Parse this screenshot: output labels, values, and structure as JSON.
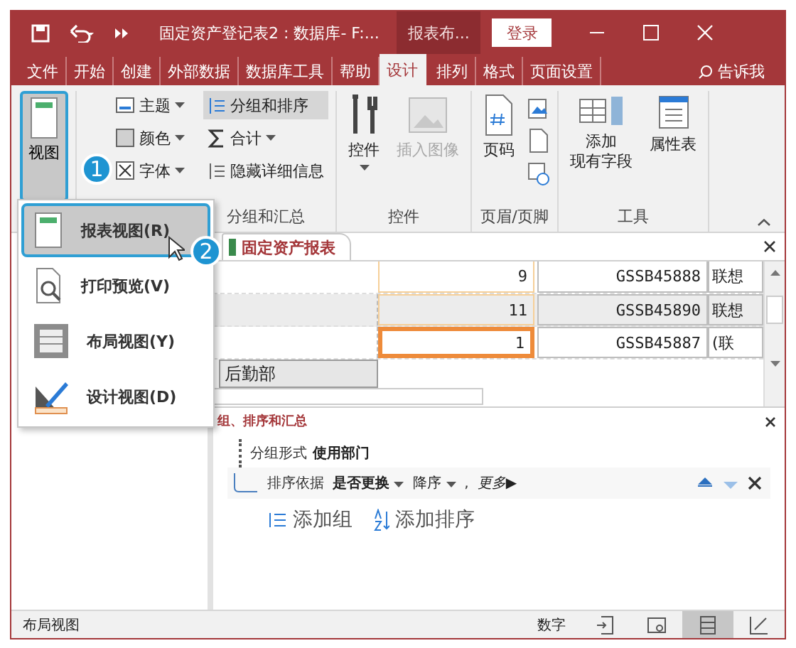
{
  "title_bar": {
    "title": "固定资产登记表2 : 数据库- F:...",
    "context_tab": "报表布...",
    "login": "登录"
  },
  "menu_tabs": [
    {
      "label": "文件",
      "selected": false
    },
    {
      "label": "开始",
      "selected": false
    },
    {
      "label": "创建",
      "selected": false
    },
    {
      "label": "外部数据",
      "selected": false
    },
    {
      "label": "数据库工具",
      "selected": false
    },
    {
      "label": "帮助",
      "selected": false
    },
    {
      "label": "设计",
      "selected": true
    },
    {
      "label": "排列",
      "selected": false
    },
    {
      "label": "格式",
      "selected": false
    },
    {
      "label": "页面设置",
      "selected": false
    }
  ],
  "tell_me": "告诉我",
  "ribbon": {
    "view_button": {
      "label": "视图",
      "selected": true
    },
    "theme_items": [
      "主题",
      "颜色",
      "字体"
    ],
    "grouping_items": [
      {
        "label": "分组和排序",
        "selected": true
      },
      {
        "label": "合计",
        "selected": false
      },
      {
        "label": "隐藏详细信息",
        "selected": false
      }
    ],
    "grouping_label": "分组和汇总",
    "controls": {
      "label": "控件",
      "insert_image": "插入图像",
      "group_label": "控件"
    },
    "header_footer": {
      "page_number": "页码",
      "group_label": "页眉/页脚"
    },
    "tools": {
      "add_fields": [
        "添加",
        "现有字段"
      ],
      "property_sheet": "属性表",
      "group_label": "工具"
    }
  },
  "view_menu": [
    {
      "label": "报表视图(R)",
      "selected": true
    },
    {
      "label": "打印预览(V)",
      "selected": false
    },
    {
      "label": "布局视图(Y)",
      "selected": false
    },
    {
      "label": "设计视图(D)",
      "selected": false
    }
  ],
  "callouts": [
    "1",
    "2"
  ],
  "document_tab": {
    "label": "固定资产报表"
  },
  "report_rows": [
    {
      "number": "9",
      "code": "GSSB45888",
      "name": "联想",
      "selected": false
    },
    {
      "number": "11",
      "code": "GSSB45890",
      "name": "联想",
      "selected": false
    },
    {
      "number": "1",
      "code": "GSSB45887",
      "name": "(联",
      "selected": true
    }
  ],
  "group_header": "后勤部",
  "group_pane": {
    "title": "组、排序和汇总",
    "group_by_label": "分组形式",
    "group_by_field": "使用部门",
    "sort_label": "排序依据",
    "sort_field": "是否更换",
    "sort_order": "降序",
    "separator": ",",
    "more": "更多▶",
    "add_group": "添加组",
    "add_sort": "添加排序"
  },
  "status_bar": {
    "mode": "布局视图",
    "indicator": "数字",
    "views": [
      {
        "kind": "report",
        "selected": false
      },
      {
        "kind": "print",
        "selected": false
      },
      {
        "kind": "layout",
        "selected": true
      },
      {
        "kind": "design",
        "selected": false
      }
    ]
  }
}
